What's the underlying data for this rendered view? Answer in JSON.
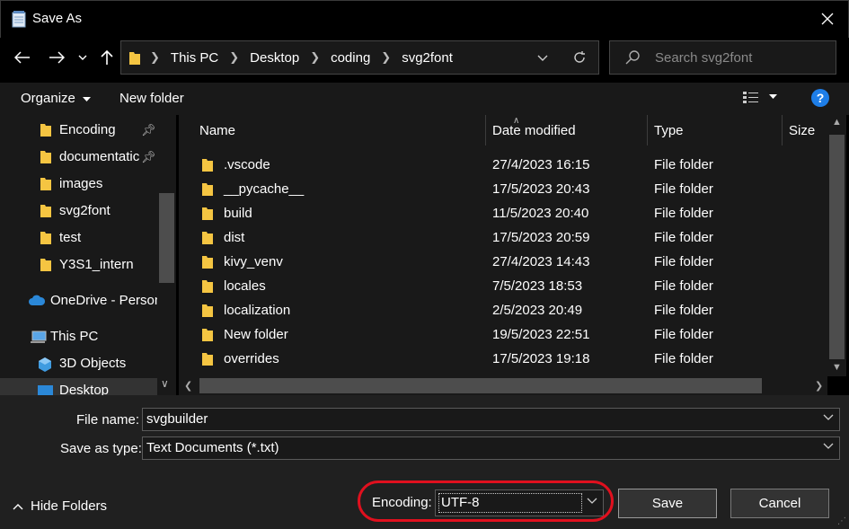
{
  "window": {
    "title": "Save As",
    "icon": "notepad-icon",
    "close_icon": "close-icon"
  },
  "address": {
    "crumbs": [
      "This PC",
      "Desktop",
      "coding",
      "svg2font"
    ],
    "search_placeholder": "Search svg2font"
  },
  "toolbar": {
    "organize_label": "Organize",
    "new_folder_label": "New folder"
  },
  "navpane": {
    "items": [
      {
        "label": "Encoding",
        "pinned": true,
        "icon": "folder-icon"
      },
      {
        "label": "documentatic",
        "pinned": true,
        "icon": "folder-icon"
      },
      {
        "label": "images",
        "pinned": false,
        "icon": "folder-icon"
      },
      {
        "label": "svg2font",
        "pinned": false,
        "icon": "folder-icon"
      },
      {
        "label": "test",
        "pinned": false,
        "icon": "folder-icon"
      },
      {
        "label": "Y3S1_intern",
        "pinned": false,
        "icon": "folder-icon"
      },
      {
        "label": "OneDrive - Person",
        "icon": "onedrive-icon"
      },
      {
        "label": "This PC",
        "icon": "computer-icon"
      },
      {
        "label": "3D Objects",
        "icon": "3d-objects-icon"
      },
      {
        "label": "Desktop",
        "icon": "desktop-icon"
      }
    ]
  },
  "filelist": {
    "columns": [
      "Name",
      "Date modified",
      "Type",
      "Size"
    ],
    "rows": [
      {
        "name": ".vscode",
        "date": "27/4/2023 16:15",
        "type": "File folder"
      },
      {
        "name": "__pycache__",
        "date": "17/5/2023 20:43",
        "type": "File folder"
      },
      {
        "name": "build",
        "date": "11/5/2023 20:40",
        "type": "File folder"
      },
      {
        "name": "dist",
        "date": "17/5/2023 20:59",
        "type": "File folder"
      },
      {
        "name": "kivy_venv",
        "date": "27/4/2023 14:43",
        "type": "File folder"
      },
      {
        "name": "locales",
        "date": "7/5/2023 18:53",
        "type": "File folder"
      },
      {
        "name": "localization",
        "date": "2/5/2023 20:49",
        "type": "File folder"
      },
      {
        "name": "New folder",
        "date": "19/5/2023 22:51",
        "type": "File folder"
      },
      {
        "name": "overrides",
        "date": "17/5/2023 19:18",
        "type": "File folder"
      }
    ]
  },
  "form": {
    "file_name_label": "File name:",
    "file_name_value": "svgbuilder",
    "save_type_label": "Save as type:",
    "save_type_value": "Text Documents (*.txt)",
    "hide_folders_label": "Hide Folders",
    "encoding_label": "Encoding:",
    "encoding_value": "UTF-8",
    "save_label": "Save",
    "cancel_label": "Cancel"
  },
  "colors": {
    "background": "#191919",
    "titlebar": "#000000",
    "folder": "#f5c542",
    "accent_help": "#1e7ee8",
    "highlight_oval": "#e0101e"
  }
}
